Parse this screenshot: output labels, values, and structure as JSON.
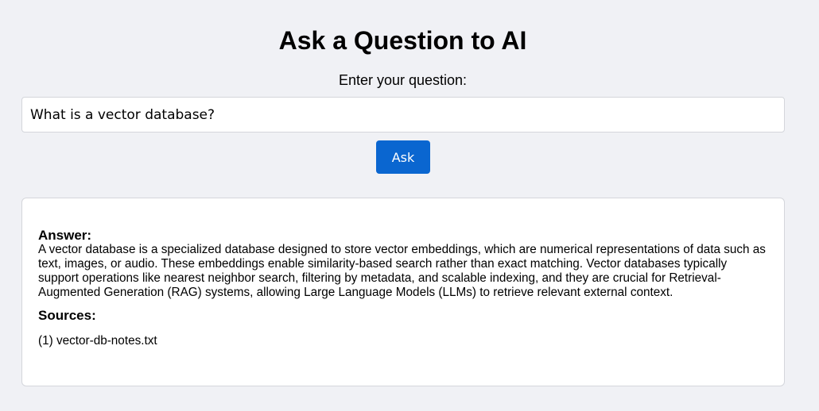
{
  "page": {
    "title": "Ask a Question to AI",
    "input_label": "Enter your question:",
    "question_value": "What is a vector database?",
    "ask_label": "Ask"
  },
  "answer": {
    "heading": "Answer:",
    "text": "A vector database is a specialized database designed to store vector embeddings, which are numerical representations of data such as text, images, or audio. These embeddings enable similarity-based search rather than exact matching. Vector databases typically support operations like nearest neighbor search, filtering by metadata, and scalable indexing, and they are crucial for Retrieval-Augmented Generation (RAG) systems, allowing Large Language Models (LLMs) to retrieve relevant external context."
  },
  "sources": {
    "heading": "Sources:",
    "items": [
      "(1) vector-db-notes.txt"
    ]
  },
  "colors": {
    "background": "#f0f1f5",
    "accent": "#0a66d0"
  }
}
